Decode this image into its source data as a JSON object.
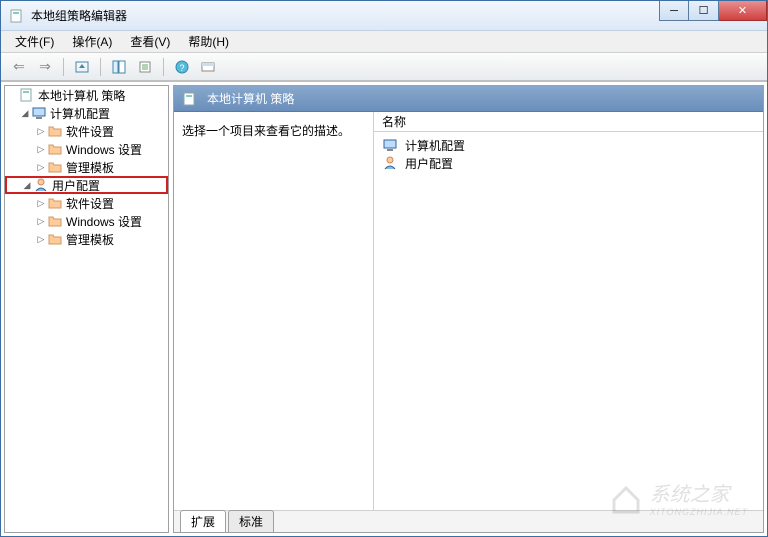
{
  "titlebar": {
    "title": "本地组策略编辑器"
  },
  "menubar": {
    "file": "文件(F)",
    "action": "操作(A)",
    "view": "查看(V)",
    "help": "帮助(H)"
  },
  "tree": {
    "root": "本地计算机 策略",
    "comp_config": "计算机配置",
    "comp_soft": "软件设置",
    "comp_win": "Windows 设置",
    "comp_admin": "管理模板",
    "user_config": "用户配置",
    "user_soft": "软件设置",
    "user_win": "Windows 设置",
    "user_admin": "管理模板"
  },
  "right": {
    "header_title": "本地计算机 策略",
    "desc": "选择一个项目来查看它的描述。",
    "col_name": "名称",
    "items": {
      "comp": "计算机配置",
      "user": "用户配置"
    }
  },
  "tabs": {
    "extended": "扩展",
    "standard": "标准"
  },
  "watermark": {
    "text": "系统之家",
    "sub": "XITONGZHIJIA.NET"
  }
}
